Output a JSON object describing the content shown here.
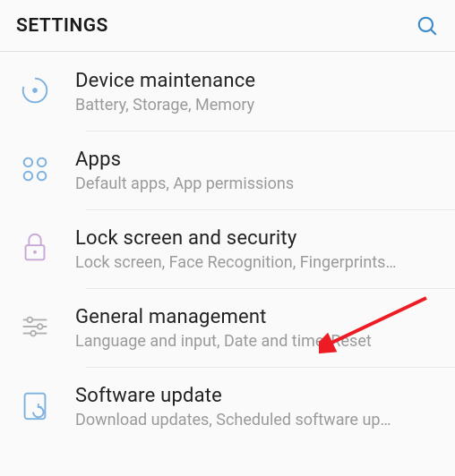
{
  "header": {
    "title": "SETTINGS"
  },
  "items": [
    {
      "icon": "device-maintenance-icon",
      "title": "Device maintenance",
      "subtitle": "Battery, Storage, Memory"
    },
    {
      "icon": "apps-icon",
      "title": "Apps",
      "subtitle": "Default apps, App permissions"
    },
    {
      "icon": "lock-icon",
      "title": "Lock screen and security",
      "subtitle": "Lock screen, Face Recognition, Fingerprints…"
    },
    {
      "icon": "sliders-icon",
      "title": "General management",
      "subtitle": "Language and input, Date and time, Reset"
    },
    {
      "icon": "software-update-icon",
      "title": "Software update",
      "subtitle": "Download updates, Scheduled software up…"
    }
  ]
}
